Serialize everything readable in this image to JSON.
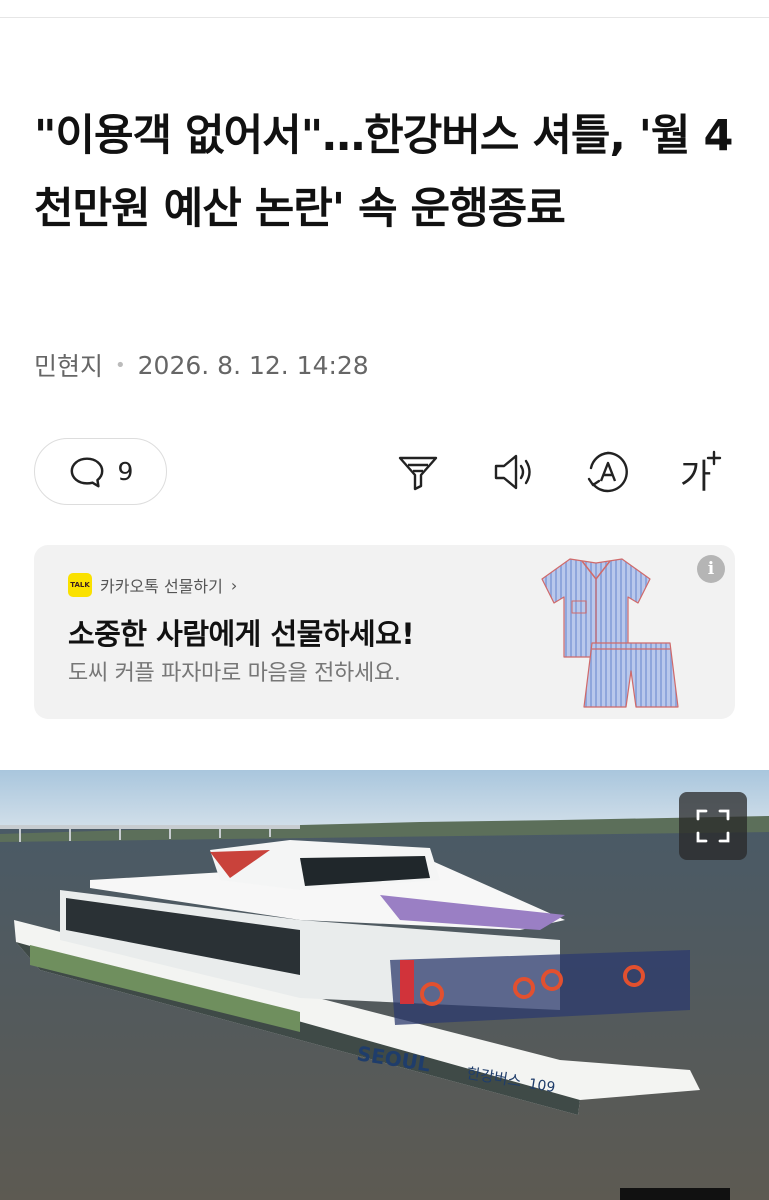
{
  "article": {
    "headline": "\"이용객 없어서\"…한강버스 셔틀, '월 4천만원 예산 논란' 속 운행종료",
    "author": "민현지",
    "date": "2026. 8. 12. 14:28",
    "comment_count": "9"
  },
  "toolbar": {
    "summary_icon": "summary-funnel-icon",
    "tts_icon": "speaker-icon",
    "translate_icon": "translate-icon",
    "font_icon": "font-size-icon",
    "font_label": "가"
  },
  "ad": {
    "brand": "카카오톡 선물하기",
    "brand_chevron": "›",
    "badge": "TALK",
    "title": "소중한 사람에게 선물하세요!",
    "subtitle": "도씨 커플 파자마로 마음을 전하세요.",
    "info": "i"
  },
  "photo": {
    "boat_brand": "SEOUL",
    "boat_name": "한강버스",
    "boat_number": "109"
  }
}
